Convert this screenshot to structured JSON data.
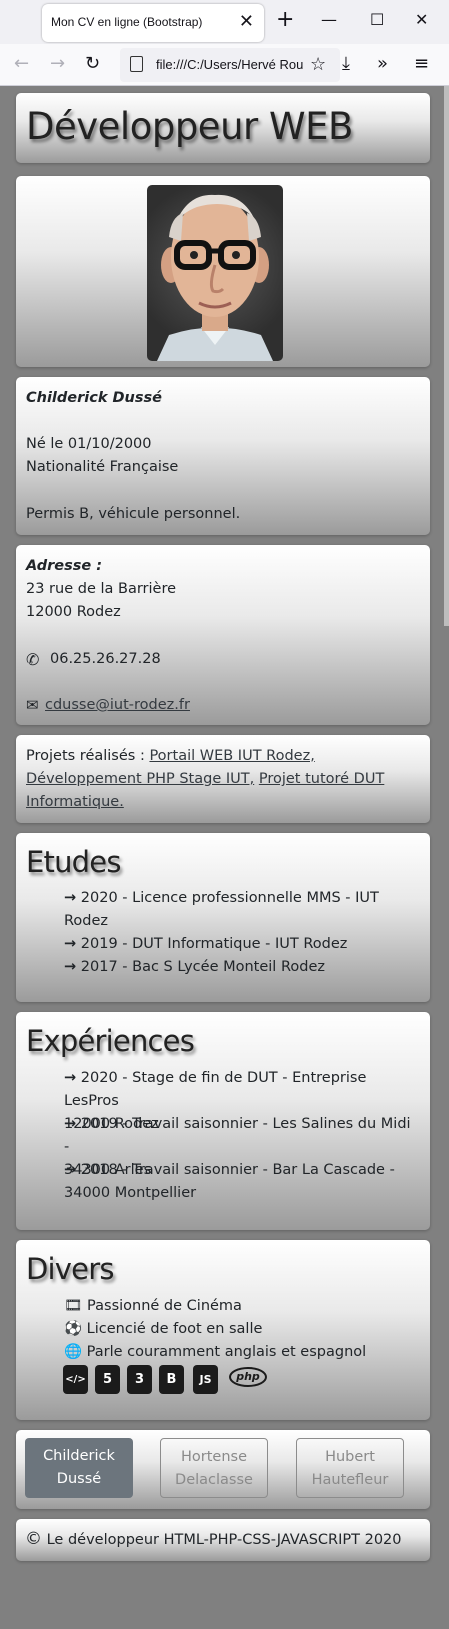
{
  "browser": {
    "tab_title": "Mon CV en ligne (Bootstrap)",
    "tab_close": "✕",
    "new_tab": "+",
    "url": "file:///C:/Users/Hervé Rou",
    "minimize": "—",
    "maximize": "☐",
    "close": "✕"
  },
  "header": {
    "title": "Développeur WEB"
  },
  "profile": {
    "name": "Childerick Dussé",
    "birth": "Né le 01/10/2000",
    "nationality": "Nationalité Française",
    "license": "Permis B, véhicule personnel."
  },
  "contact": {
    "address_label": "Adresse :",
    "street": "23 rue de la Barrière",
    "city": "12000 Rodez",
    "phone": "06.25.26.27.28",
    "email": "cdusse@iut-rodez.fr"
  },
  "projects": {
    "label": "Projets réalisés : ",
    "items": [
      "Portail WEB IUT Rodez,",
      "Développement PHP Stage IUT,",
      "Projet tutoré DUT",
      "Informatique."
    ]
  },
  "studies": {
    "title": "Etudes",
    "items": [
      {
        "line1": "2020 - Licence professionnelle MMS - IUT",
        "line2": "Rodez"
      },
      {
        "line1": "2019 - DUT Informatique - IUT Rodez"
      },
      {
        "line1": "2017 - Bac S Lycée Monteil Rodez"
      }
    ]
  },
  "experiences": {
    "title": "Expériences",
    "items": [
      {
        "line1": "2020 - Stage de fin de DUT - Entreprise LesPros",
        "line2": "12000 Rodez"
      },
      {
        "line1": "2019 - Travail saisonnier - Les Salines du Midi -",
        "line2": "34300 Arles"
      },
      {
        "line1": "2018 - Travail saisonnier - Bar La Cascade -",
        "line2": "34000 Montpellier"
      }
    ]
  },
  "misc": {
    "title": "Divers",
    "items": [
      "Passionné de Cinéma",
      "Licencié de foot en salle",
      "Parle couramment anglais et espagnol"
    ],
    "tech": [
      "</>",
      "5",
      "3",
      "B",
      "JS",
      "php"
    ]
  },
  "people": [
    {
      "line1": "Childerick",
      "line2": "Dussé"
    },
    {
      "line1": "Hortense",
      "line2": "Delaclasse"
    },
    {
      "line1": "Hubert",
      "line2": "Hautefleur"
    }
  ],
  "footer": {
    "text": "Le développeur HTML-PHP-CSS-JAVASCRIPT 2020"
  }
}
